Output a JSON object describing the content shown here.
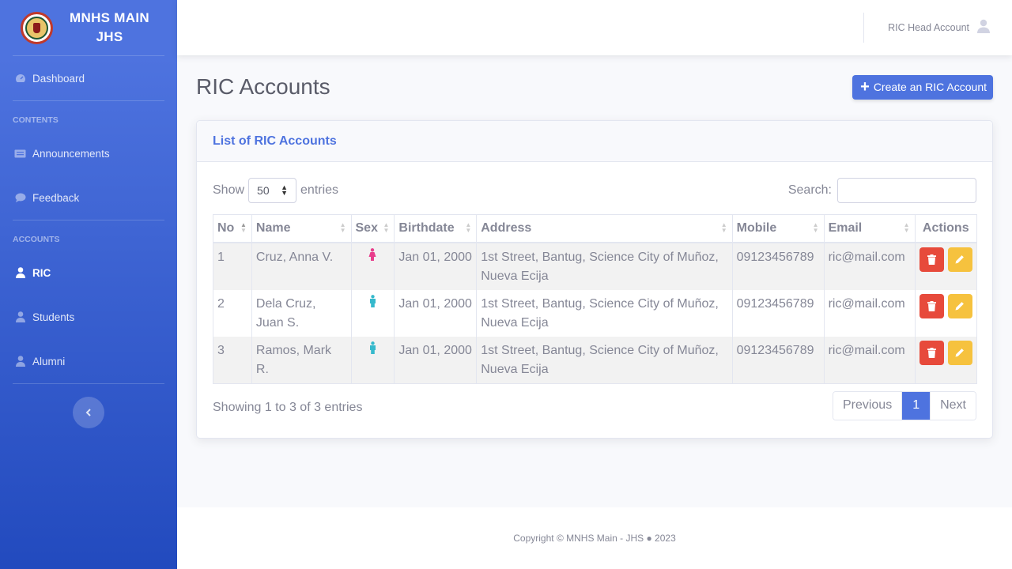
{
  "sidebar": {
    "brand_line1": "MNHS MAIN",
    "brand_line2": "JHS",
    "items": {
      "dashboard": {
        "label": "Dashboard",
        "icon": "tachometer-icon"
      },
      "announcements": {
        "label": "Announcements",
        "icon": "newspaper-icon"
      },
      "feedback": {
        "label": "Feedback",
        "icon": "comment-icon"
      },
      "ric": {
        "label": "RIC",
        "icon": "user-icon",
        "active": true
      },
      "students": {
        "label": "Students",
        "icon": "user-icon"
      },
      "alumni": {
        "label": "Alumni",
        "icon": "user-icon"
      }
    },
    "headings": {
      "contents": "CONTENTS",
      "accounts": "ACCOUNTS"
    },
    "toggle_icon": "chevron-left-icon"
  },
  "topbar": {
    "user_name": "RIC Head Account",
    "user_icon": "user-circle-icon"
  },
  "page": {
    "title": "RIC Accounts",
    "create_button": "Create an RIC Account"
  },
  "card": {
    "title": "List of RIC Accounts",
    "show_label": "Show",
    "entries_label": "entries",
    "page_length": "50",
    "search_label": "Search:",
    "search_value": "",
    "columns": [
      "No",
      "Name",
      "Sex",
      "Birthdate",
      "Address",
      "Mobile",
      "Email",
      "Actions"
    ],
    "rows": [
      {
        "no": "1",
        "name": "Cruz, Anna V.",
        "sex": "female",
        "birthdate": "Jan 01, 2000",
        "address": "1st Street, Bantug, Science City of Muñoz, Nueva Ecija",
        "mobile": "09123456789",
        "email": "ric@mail.com"
      },
      {
        "no": "2",
        "name": "Dela Cruz, Juan S.",
        "sex": "male",
        "birthdate": "Jan 01, 2000",
        "address": "1st Street, Bantug, Science City of Muñoz, Nueva Ecija",
        "mobile": "09123456789",
        "email": "ric@mail.com"
      },
      {
        "no": "3",
        "name": "Ramos, Mark R.",
        "sex": "male",
        "birthdate": "Jan 01, 2000",
        "address": "1st Street, Bantug, Science City of Muñoz, Nueva Ecija",
        "mobile": "09123456789",
        "email": "ric@mail.com"
      }
    ],
    "info": "Showing 1 to 3 of 3 entries",
    "pagination": {
      "previous": "Previous",
      "current": "1",
      "next": "Next"
    }
  },
  "footer": {
    "copyright": "Copyright © MNHS Main - JHS ● 2023"
  },
  "colors": {
    "primary": "#4e73df",
    "danger": "#e74a3b",
    "warning": "#f6c23e",
    "female": "#e83e8c",
    "male": "#36b9cc"
  }
}
